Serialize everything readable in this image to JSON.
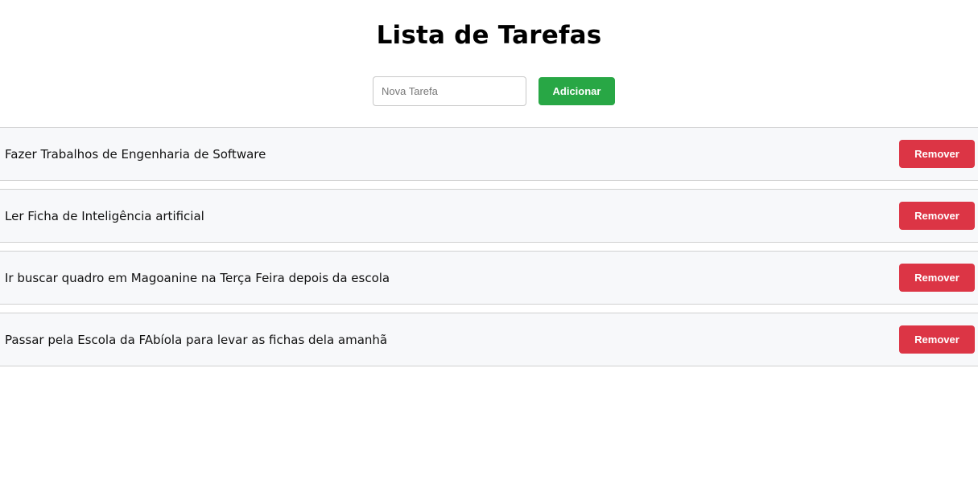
{
  "header": {
    "title": "Lista de Tarefas"
  },
  "form": {
    "input_value": "",
    "input_placeholder": "Nova Tarefa",
    "add_label": "Adicionar"
  },
  "tasks": [
    {
      "text": "Fazer Trabalhos de Engenharia de Software",
      "remove_label": "Remover"
    },
    {
      "text": "Ler Ficha de Inteligência artificial",
      "remove_label": "Remover"
    },
    {
      "text": "Ir buscar quadro em Magoanine na Terça Feira depois da escola",
      "remove_label": "Remover"
    },
    {
      "text": "Passar pela Escola da FAbíola para levar as fichas dela amanhã",
      "remove_label": "Remover"
    }
  ],
  "colors": {
    "add_button": "#28a745",
    "remove_button": "#dc3545",
    "row_background": "#f7f8fa",
    "row_border": "#d0d0d0"
  }
}
